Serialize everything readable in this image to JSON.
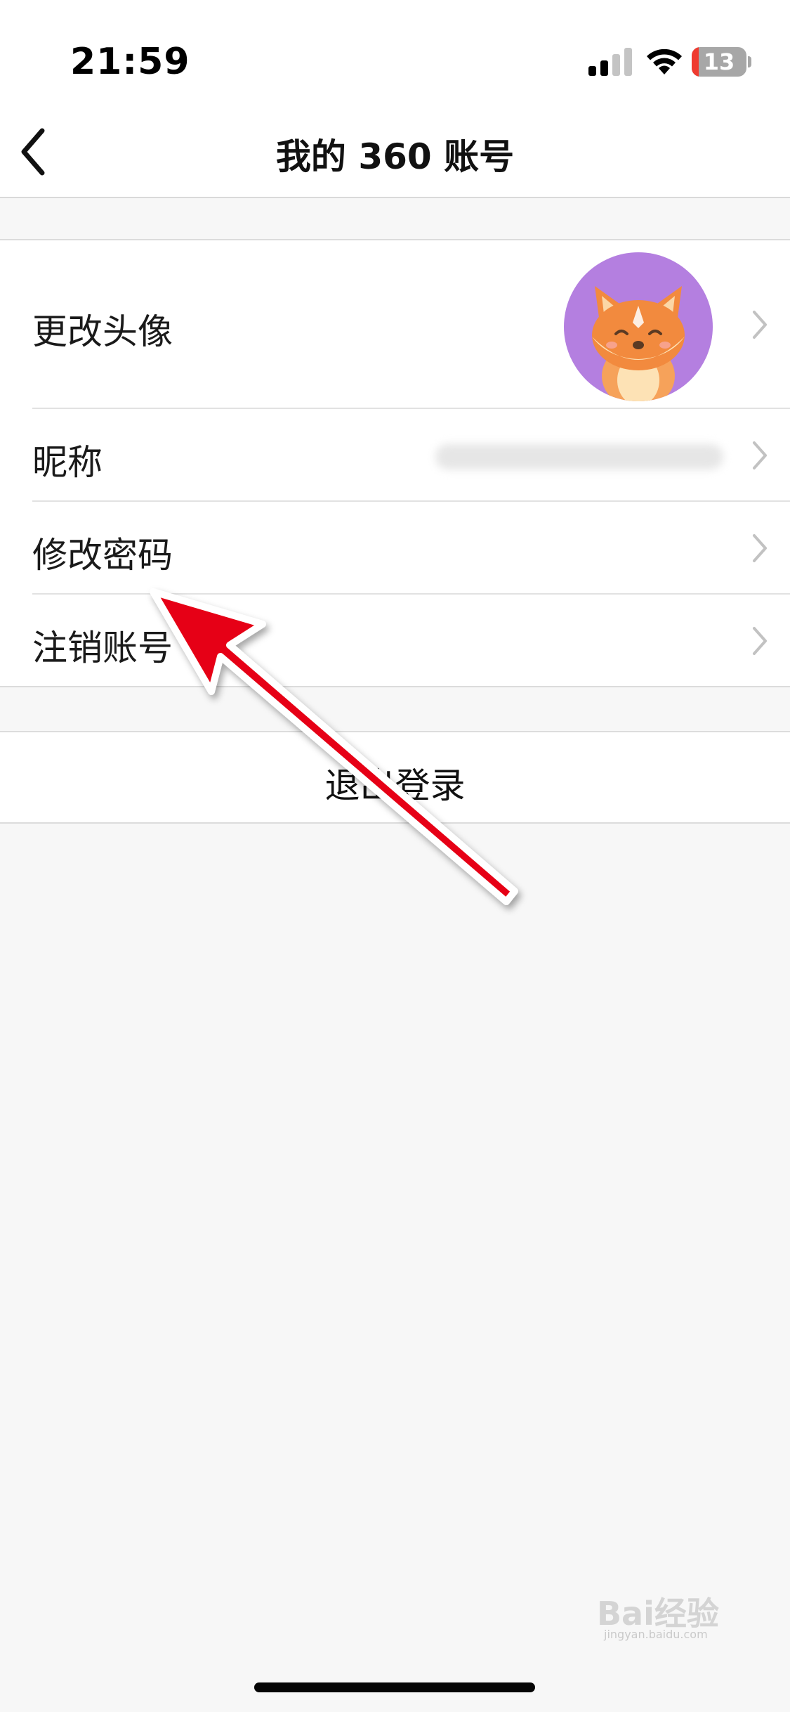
{
  "status_bar": {
    "time": "21:59",
    "battery_level": "13",
    "battery_fraction": 0.13,
    "battery_color": "#ef3b30"
  },
  "nav": {
    "back_icon": "chevron-left-icon",
    "title": "我的 360 账号"
  },
  "settings": {
    "items": [
      {
        "label": "更改头像",
        "icon": "chevron-right-icon"
      },
      {
        "label": "昵称",
        "icon": "chevron-right-icon"
      },
      {
        "label": "修改密码",
        "icon": "chevron-right-icon"
      },
      {
        "label": "注销账号",
        "icon": "chevron-right-icon"
      }
    ],
    "avatar_bg": "#b47fe0"
  },
  "logout": {
    "label": "退出登录"
  },
  "annotation": {
    "arrow_color": "#e60012"
  },
  "watermark": {
    "text": "Bai经验",
    "sub": "jingyan.baidu.com"
  }
}
